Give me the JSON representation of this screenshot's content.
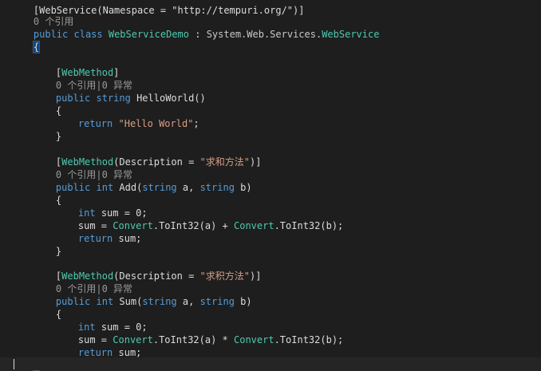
{
  "code": {
    "top_cut": "[WebService(Namespace = \"http://tempuri.org/\")]",
    "lens_class": "0 个引用",
    "class_decl": {
      "kw1": "public",
      "kw2": "class",
      "name": "WebServiceDemo",
      "colon": " : ",
      "ns": "System.Web.Services.",
      "base": "WebService"
    },
    "open_brace": "{",
    "close_brace": "}",
    "methods": [
      {
        "attr_open": "[",
        "attr_name": "WebMethod",
        "attr_rest": "]",
        "attr_desc": "",
        "attr_end": "",
        "lens": "0 个引用|0 异常",
        "sig": "public string HelloWorld()",
        "lines": [
          "return \"Hello World\";"
        ]
      },
      {
        "attr_open": "[",
        "attr_name": "WebMethod",
        "attr_rest": "(Description = ",
        "attr_desc": "\"求和方法\"",
        "attr_end": ")]",
        "lens": "0 个引用|0 异常",
        "sig": "public int Add(string a, string b)",
        "lines": [
          "int sum = 0;",
          "sum = Convert.ToInt32(a) + Convert.ToInt32(b);",
          "return sum;"
        ]
      },
      {
        "attr_open": "[",
        "attr_name": "WebMethod",
        "attr_rest": "(Description = ",
        "attr_desc": "\"求积方法\"",
        "attr_end": ")]",
        "lens": "0 个引用|0 异常",
        "sig": "public int Sum(string a, string b)",
        "lines": [
          "int sum = 0;",
          "sum = Convert.ToInt32(a) * Convert.ToInt32(b);",
          "return sum;"
        ]
      }
    ],
    "tokens": {
      "public": "public",
      "string": "string",
      "int": "int",
      "return": "return",
      "convert": "Convert",
      "toint32": ".ToInt32",
      "hello_name": " HelloWorld()",
      "hello_str": "\"Hello World\"",
      "semi": ";",
      "add_name": " Add(",
      "sum_name": " Sum(",
      "param_a": " a, ",
      "param_b": " b)",
      "sum_init": " sum = 0;",
      "sum_assign": "sum = ",
      "arg_a": "(a) ",
      "plus": "+ ",
      "times": "* ",
      "arg_b": "(b);",
      "ret_sum": " sum;"
    }
  }
}
